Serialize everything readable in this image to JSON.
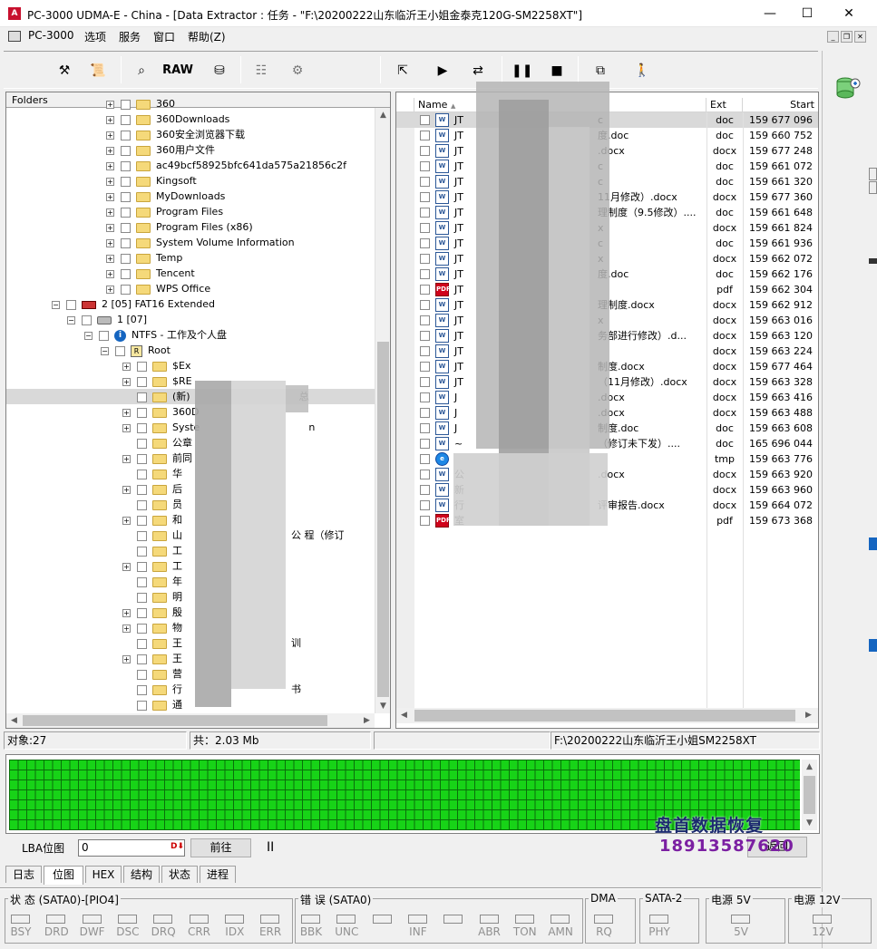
{
  "window": {
    "title": "PC-3000 UDMA-E - China - [Data Extractor : 任务 - \"F:\\20200222山东临沂王小姐金泰克120G-SM2258XT\"]",
    "app_icon_text": "A",
    "minimize": "—",
    "maximize": "☐",
    "close": "✕"
  },
  "menu": [
    "PC-3000",
    "选项",
    "服务",
    "窗口",
    "帮助(Z)"
  ],
  "toolbar": {
    "raw_label": "RAW"
  },
  "tree": {
    "header": "Folders",
    "rows": [
      {
        "level": 1,
        "label": "360",
        "icon": "folder",
        "exp": "+"
      },
      {
        "level": 1,
        "label": "360Downloads",
        "icon": "folder",
        "exp": "+"
      },
      {
        "level": 1,
        "label": "360安全浏览器下载",
        "icon": "folder",
        "exp": "+"
      },
      {
        "level": 1,
        "label": "360用户文件",
        "icon": "folder",
        "exp": "+"
      },
      {
        "level": 1,
        "label": "ac49bcf58925bfc641da575a21856c2f",
        "icon": "folder",
        "exp": "+"
      },
      {
        "level": 1,
        "label": "Kingsoft",
        "icon": "folder",
        "exp": "+"
      },
      {
        "level": 1,
        "label": "MyDownloads",
        "icon": "folder",
        "exp": "+"
      },
      {
        "level": 1,
        "label": "Program Files",
        "icon": "folder",
        "exp": "+"
      },
      {
        "level": 1,
        "label": "Program Files (x86)",
        "icon": "folder",
        "exp": "+"
      },
      {
        "level": 1,
        "label": "System Volume Information",
        "icon": "folder",
        "exp": "+"
      },
      {
        "level": 1,
        "label": "Temp",
        "icon": "folder",
        "exp": "+"
      },
      {
        "level": 1,
        "label": "Tencent",
        "icon": "folder",
        "exp": "+"
      },
      {
        "level": 1,
        "label": "WPS Office",
        "icon": "folder",
        "exp": "+"
      },
      {
        "level": -2,
        "label": "2 [05] FAT16 Extended",
        "icon": "ext",
        "exp": "−"
      },
      {
        "level": -1,
        "label": "1 [07]",
        "icon": "hdd",
        "exp": "−"
      },
      {
        "level": 0,
        "label": "NTFS - 工作及个人盘",
        "icon": "info",
        "exp": "−"
      },
      {
        "level": 0.5,
        "label": "Root",
        "icon": "root",
        "exp": "−"
      },
      {
        "level": 2,
        "label": "$Ex",
        "icon": "folder",
        "exp": "+"
      },
      {
        "level": 2,
        "label": "$RE",
        "icon": "folder",
        "exp": "+"
      },
      {
        "level": 2,
        "label": "(新)",
        "icon": "folder",
        "exp": "",
        "tail": "总",
        "selected": true
      },
      {
        "level": 2,
        "label": "360D",
        "icon": "folder",
        "exp": "+"
      },
      {
        "level": 2,
        "label": "Syste",
        "icon": "folder",
        "exp": "+",
        "tail": "n"
      },
      {
        "level": 2,
        "label": "公章",
        "icon": "folder",
        "exp": ""
      },
      {
        "level": 2,
        "label": "前同",
        "icon": "folder",
        "exp": "+"
      },
      {
        "level": 2,
        "label": "华",
        "icon": "folder",
        "exp": ""
      },
      {
        "level": 2,
        "label": "后",
        "icon": "folder",
        "exp": "+"
      },
      {
        "level": 2,
        "label": "员",
        "icon": "folder",
        "exp": ""
      },
      {
        "level": 2,
        "label": "和",
        "icon": "folder",
        "exp": "+"
      },
      {
        "level": 2,
        "label": "山",
        "icon": "folder",
        "exp": "",
        "tail": "公     程（修订"
      },
      {
        "level": 2,
        "label": "工",
        "icon": "folder",
        "exp": ""
      },
      {
        "level": 2,
        "label": "工",
        "icon": "folder",
        "exp": "+"
      },
      {
        "level": 2,
        "label": "年",
        "icon": "folder",
        "exp": ""
      },
      {
        "level": 2,
        "label": "明",
        "icon": "folder",
        "exp": ""
      },
      {
        "level": 2,
        "label": "殷",
        "icon": "folder",
        "exp": "+"
      },
      {
        "level": 2,
        "label": "物",
        "icon": "folder",
        "exp": "+"
      },
      {
        "level": 2,
        "label": "王",
        "icon": "folder",
        "exp": "",
        "tail": "训"
      },
      {
        "level": 2,
        "label": "王",
        "icon": "folder",
        "exp": "+"
      },
      {
        "level": 2,
        "label": "营",
        "icon": "folder",
        "exp": ""
      },
      {
        "level": 2,
        "label": "行",
        "icon": "folder",
        "exp": "",
        "tail": "书"
      },
      {
        "level": 2,
        "label": "通",
        "icon": "folder",
        "exp": ""
      }
    ]
  },
  "list": {
    "columns": {
      "name": "Name",
      "ext": "Ext",
      "start": "Start"
    },
    "rows": [
      {
        "name": "JT",
        "tail": "c",
        "icon": "W",
        "ext": "doc",
        "start": "159 677 096"
      },
      {
        "name": "JT",
        "tail": "度.doc",
        "icon": "W",
        "ext": "doc",
        "start": "159 660 752"
      },
      {
        "name": "JT",
        "tail": ".docx",
        "icon": "W",
        "ext": "docx",
        "start": "159 677 248"
      },
      {
        "name": "JT",
        "tail": "c",
        "icon": "W",
        "ext": "doc",
        "start": "159 661 072"
      },
      {
        "name": "JT",
        "tail": "c",
        "icon": "W",
        "ext": "doc",
        "start": "159 661 320"
      },
      {
        "name": "JT",
        "tail": "11月修改）.docx",
        "icon": "W",
        "ext": "docx",
        "start": "159 677 360"
      },
      {
        "name": "JT",
        "tail": "理制度（9.5修改）....",
        "icon": "W",
        "ext": "doc",
        "start": "159 661 648"
      },
      {
        "name": "JT",
        "tail": "x",
        "icon": "W",
        "ext": "docx",
        "start": "159 661 824"
      },
      {
        "name": "JT",
        "tail": "c",
        "icon": "W",
        "ext": "doc",
        "start": "159 661 936"
      },
      {
        "name": "JT",
        "tail": "x",
        "icon": "W",
        "ext": "docx",
        "start": "159 662 072"
      },
      {
        "name": "JT",
        "tail": "度.doc",
        "icon": "W",
        "ext": "doc",
        "start": "159 662 176"
      },
      {
        "name": "JT",
        "tail": "",
        "icon": "PDF",
        "ext": "pdf",
        "start": "159 662 304"
      },
      {
        "name": "JT",
        "tail": "理制度.docx",
        "icon": "W",
        "ext": "docx",
        "start": "159 662 912"
      },
      {
        "name": "JT",
        "tail": "x",
        "icon": "W",
        "ext": "docx",
        "start": "159 663 016"
      },
      {
        "name": "JT",
        "tail": "务部进行修改）.d...",
        "icon": "W",
        "ext": "docx",
        "start": "159 663 120"
      },
      {
        "name": "JT",
        "tail": "",
        "icon": "W",
        "ext": "docx",
        "start": "159 663 224"
      },
      {
        "name": "JT",
        "tail": "制度.docx",
        "icon": "W",
        "ext": "docx",
        "start": "159 677 464"
      },
      {
        "name": "JT",
        "tail": "（11月修改）.docx",
        "icon": "W",
        "ext": "docx",
        "start": "159 663 328"
      },
      {
        "name": "J",
        "tail": ".docx",
        "icon": "W",
        "ext": "docx",
        "start": "159 663 416"
      },
      {
        "name": "J",
        "tail": ".docx",
        "icon": "W",
        "ext": "docx",
        "start": "159 663 488"
      },
      {
        "name": "J",
        "tail": "制度.doc",
        "icon": "W",
        "ext": "doc",
        "start": "159 663 608"
      },
      {
        "name": "~",
        "tail": "（修订未下发）....",
        "icon": "W",
        "ext": "doc",
        "start": "165 696 044"
      },
      {
        "name": "",
        "tail": "",
        "icon": "e",
        "ext": "tmp",
        "start": "159 663 776"
      },
      {
        "name": "公",
        "tail": ".docx",
        "icon": "W",
        "ext": "docx",
        "start": "159 663 920"
      },
      {
        "name": "新",
        "tail": "",
        "icon": "W",
        "ext": "docx",
        "start": "159 663 960"
      },
      {
        "name": "行",
        "tail": "评审报告.docx",
        "icon": "W",
        "ext": "docx",
        "start": "159 664 072"
      },
      {
        "name": "室",
        "tail": "",
        "icon": "PDF",
        "ext": "pdf",
        "start": "159 673 368"
      }
    ]
  },
  "status": {
    "objects": "对象:27",
    "total": "共：2.03 Mb",
    "path": "F:\\20200222山东临沂王小姐SM2258XT"
  },
  "bitmap": {
    "lba_label": "LBA位图",
    "lba_value": "0",
    "forward": "前往",
    "pause": "II",
    "back": "返回",
    "watermark_title": "盘首数据恢复",
    "watermark_phone": "18913587620"
  },
  "tabs": [
    "日志",
    "位图",
    "HEX",
    "结构",
    "状态",
    "进程"
  ],
  "indicators": {
    "status_title": "状 态 (SATA0)-[PIO4]",
    "status_leds": [
      "BSY",
      "DRD",
      "DWF",
      "DSC",
      "DRQ",
      "CRR",
      "IDX",
      "ERR"
    ],
    "error_title": "错 误 (SATA0)",
    "error_leds": [
      "BBK",
      "UNC",
      "",
      "INF",
      "",
      "ABR",
      "TON",
      "AMN"
    ],
    "dma_title": "DMA",
    "dma_leds": [
      "RQ"
    ],
    "sata_title": "SATA-2",
    "sata_leds": [
      "PHY"
    ],
    "p5_title": "电源 5V",
    "p5_leds": [
      "5V"
    ],
    "p12_title": "电源 12V",
    "p12_leds": [
      "12V"
    ]
  },
  "colors": {
    "bitmap_fill": "#17d317",
    "bitmap_grid": "#0b6e0b",
    "selection": "#d9d9d9"
  }
}
